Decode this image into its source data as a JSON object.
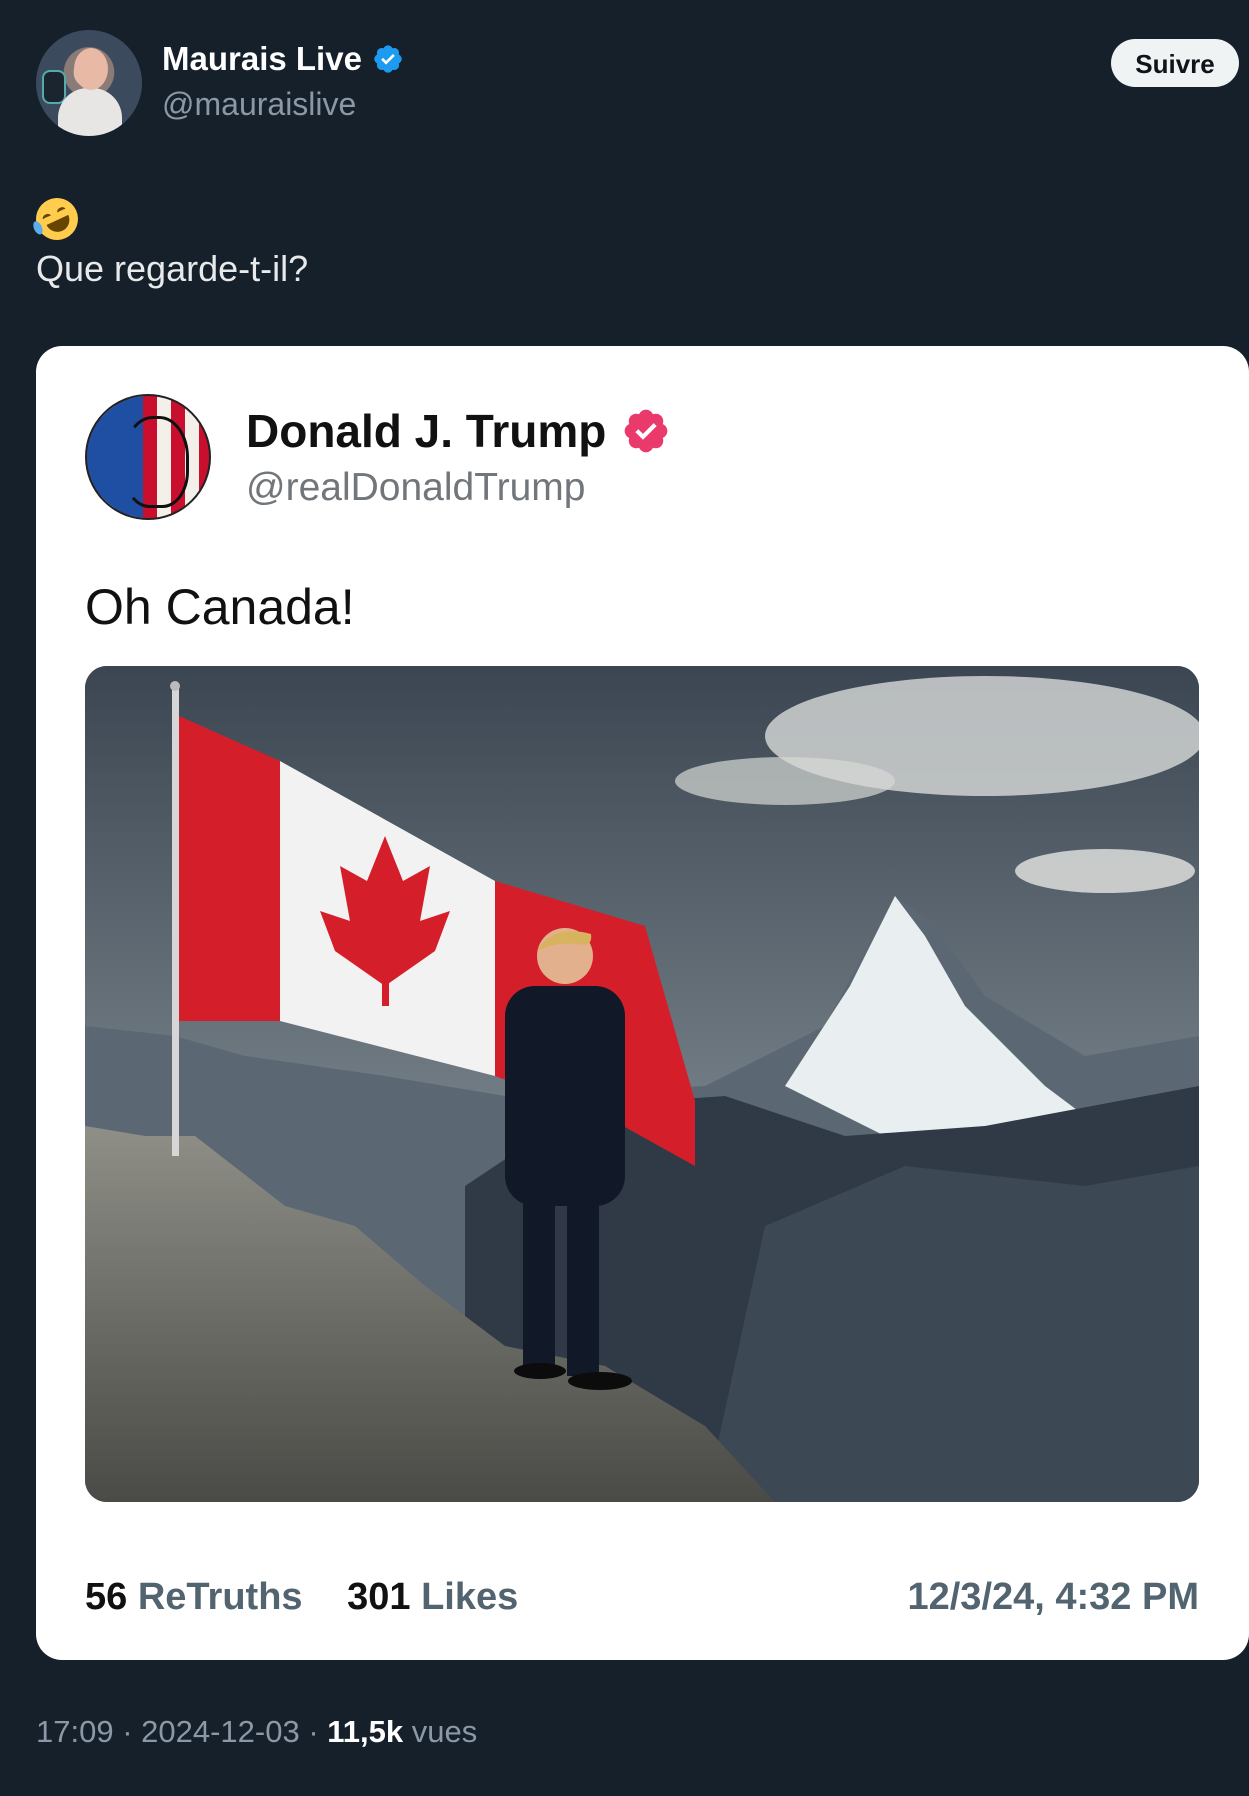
{
  "author": {
    "display_name": "Maurais Live",
    "handle": "@mauraislive",
    "follow_label": "Suivre"
  },
  "tweet": {
    "emoji": "rolling-on-floor-laughing-emoji",
    "text": "Que regarde-t-il?"
  },
  "quoted_post": {
    "display_name": "Donald J. Trump",
    "handle": "@realDonaldTrump",
    "text": "Oh Canada!",
    "retruths_count": "56",
    "retruths_label": "ReTruths",
    "likes_count": "301",
    "likes_label": "Likes",
    "datetime": "12/3/24, 4:32 PM"
  },
  "meta": {
    "time": "17:09",
    "date": "2024-12-03",
    "separator": " · ",
    "views_count": "11,5k",
    "views_label": "vues"
  },
  "colors": {
    "background": "#15202b",
    "truth_verified": "#ea3a6b",
    "x_verified": "#1d9bf0"
  }
}
